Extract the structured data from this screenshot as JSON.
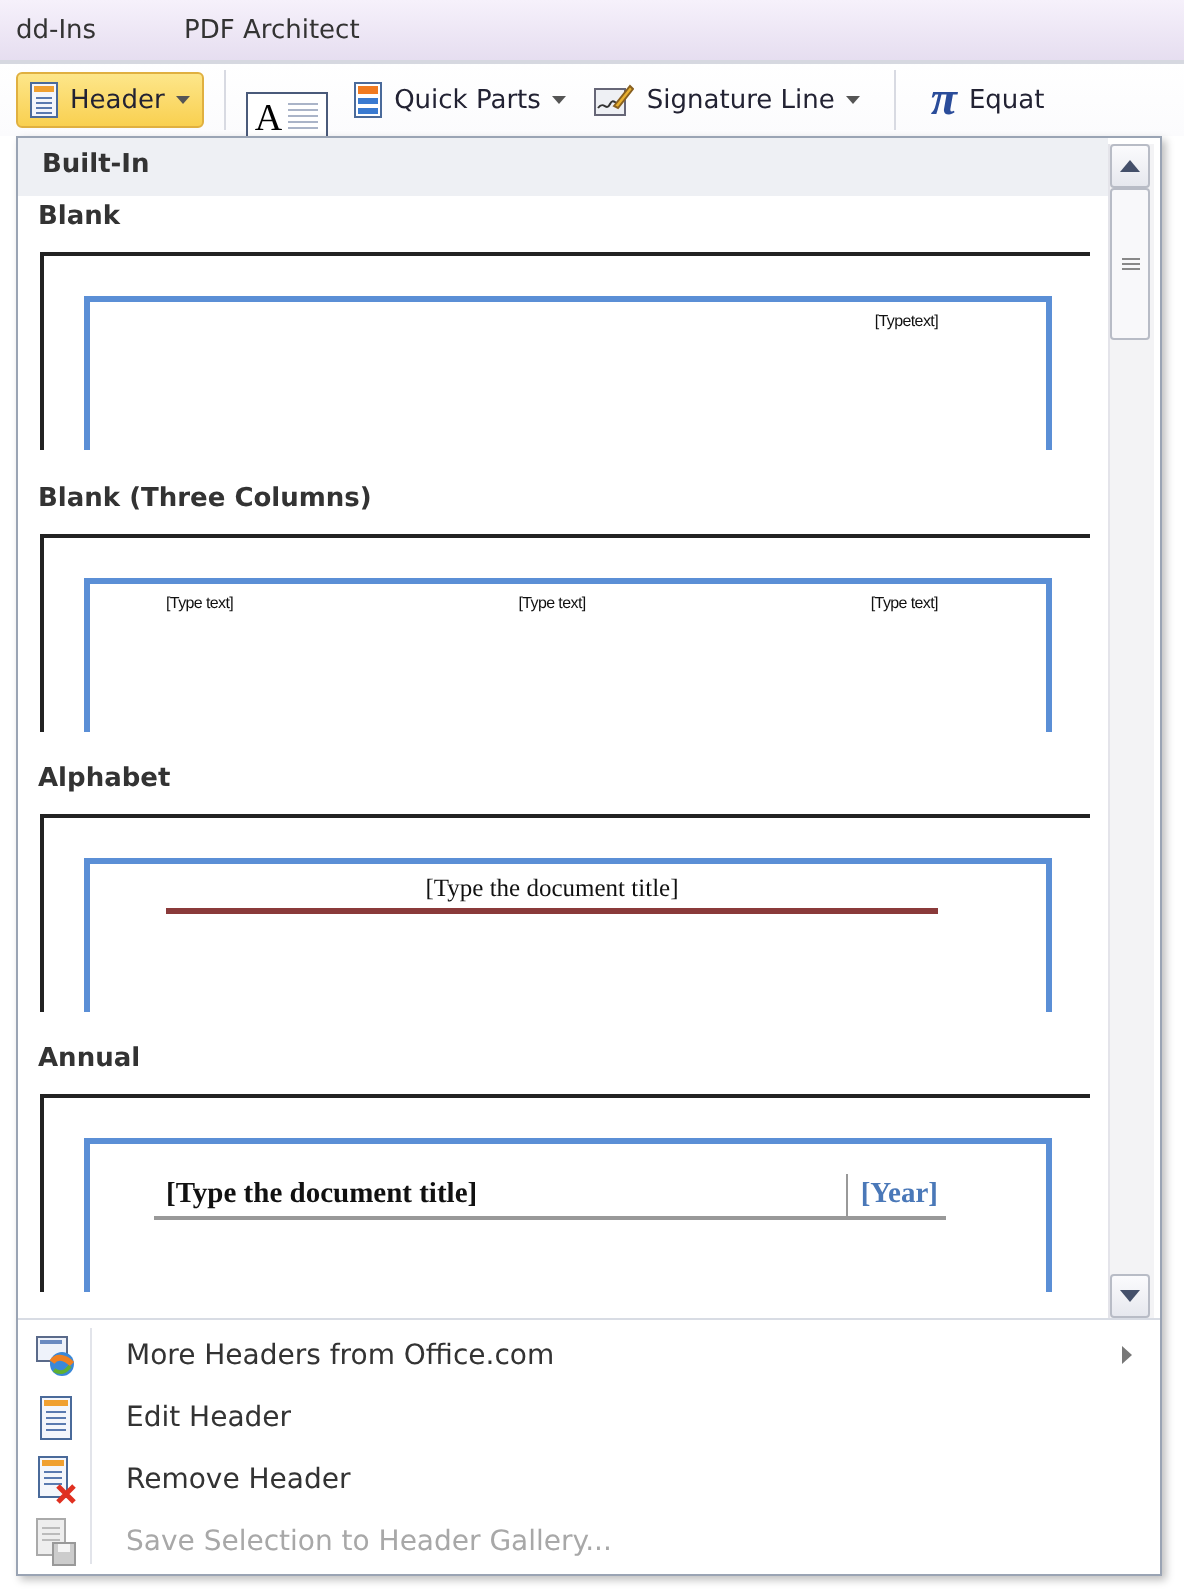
{
  "ribbon": {
    "tabs": [
      {
        "label": "dd-Ins"
      },
      {
        "label": "PDF Architect"
      }
    ],
    "buttons": [
      {
        "kind": "header",
        "label": "Header",
        "dropdown": true,
        "selected": true
      },
      {
        "kind": "textbox",
        "icon": "A",
        "dropdown": false,
        "selected": false
      },
      {
        "kind": "quick_parts",
        "label": "Quick Parts",
        "dropdown": true,
        "selected": false
      },
      {
        "kind": "signature",
        "label": "Signature Line",
        "dropdown": true,
        "selected": false
      },
      {
        "kind": "equation",
        "icon": "π",
        "label": "Equat",
        "dropdown": false,
        "selected": false
      }
    ]
  },
  "gallery": {
    "section": "Built-In",
    "items": [
      {
        "name": "Blank",
        "kind": "blank",
        "texts": [
          "[Typetext]"
        ]
      },
      {
        "name": "Blank (Three Columns)",
        "kind": "three_columns",
        "texts": [
          "[Type text]",
          "[Type text]",
          "[Type text]"
        ]
      },
      {
        "name": "Alphabet",
        "kind": "alphabet",
        "texts": [
          "[Type the document title]"
        ]
      },
      {
        "name": "Annual",
        "kind": "annual",
        "texts": [
          "[Type the document title]",
          "[Year]"
        ]
      }
    ]
  },
  "menu": [
    {
      "label": "More Headers from Office.com",
      "kind": "online",
      "submenu": true,
      "disabled": false
    },
    {
      "label": "Edit Header",
      "kind": "edit",
      "submenu": false,
      "disabled": false
    },
    {
      "label": "Remove Header",
      "kind": "remove",
      "submenu": false,
      "disabled": false
    },
    {
      "label": "Save Selection to Header Gallery...",
      "kind": "save",
      "submenu": false,
      "disabled": true
    }
  ]
}
